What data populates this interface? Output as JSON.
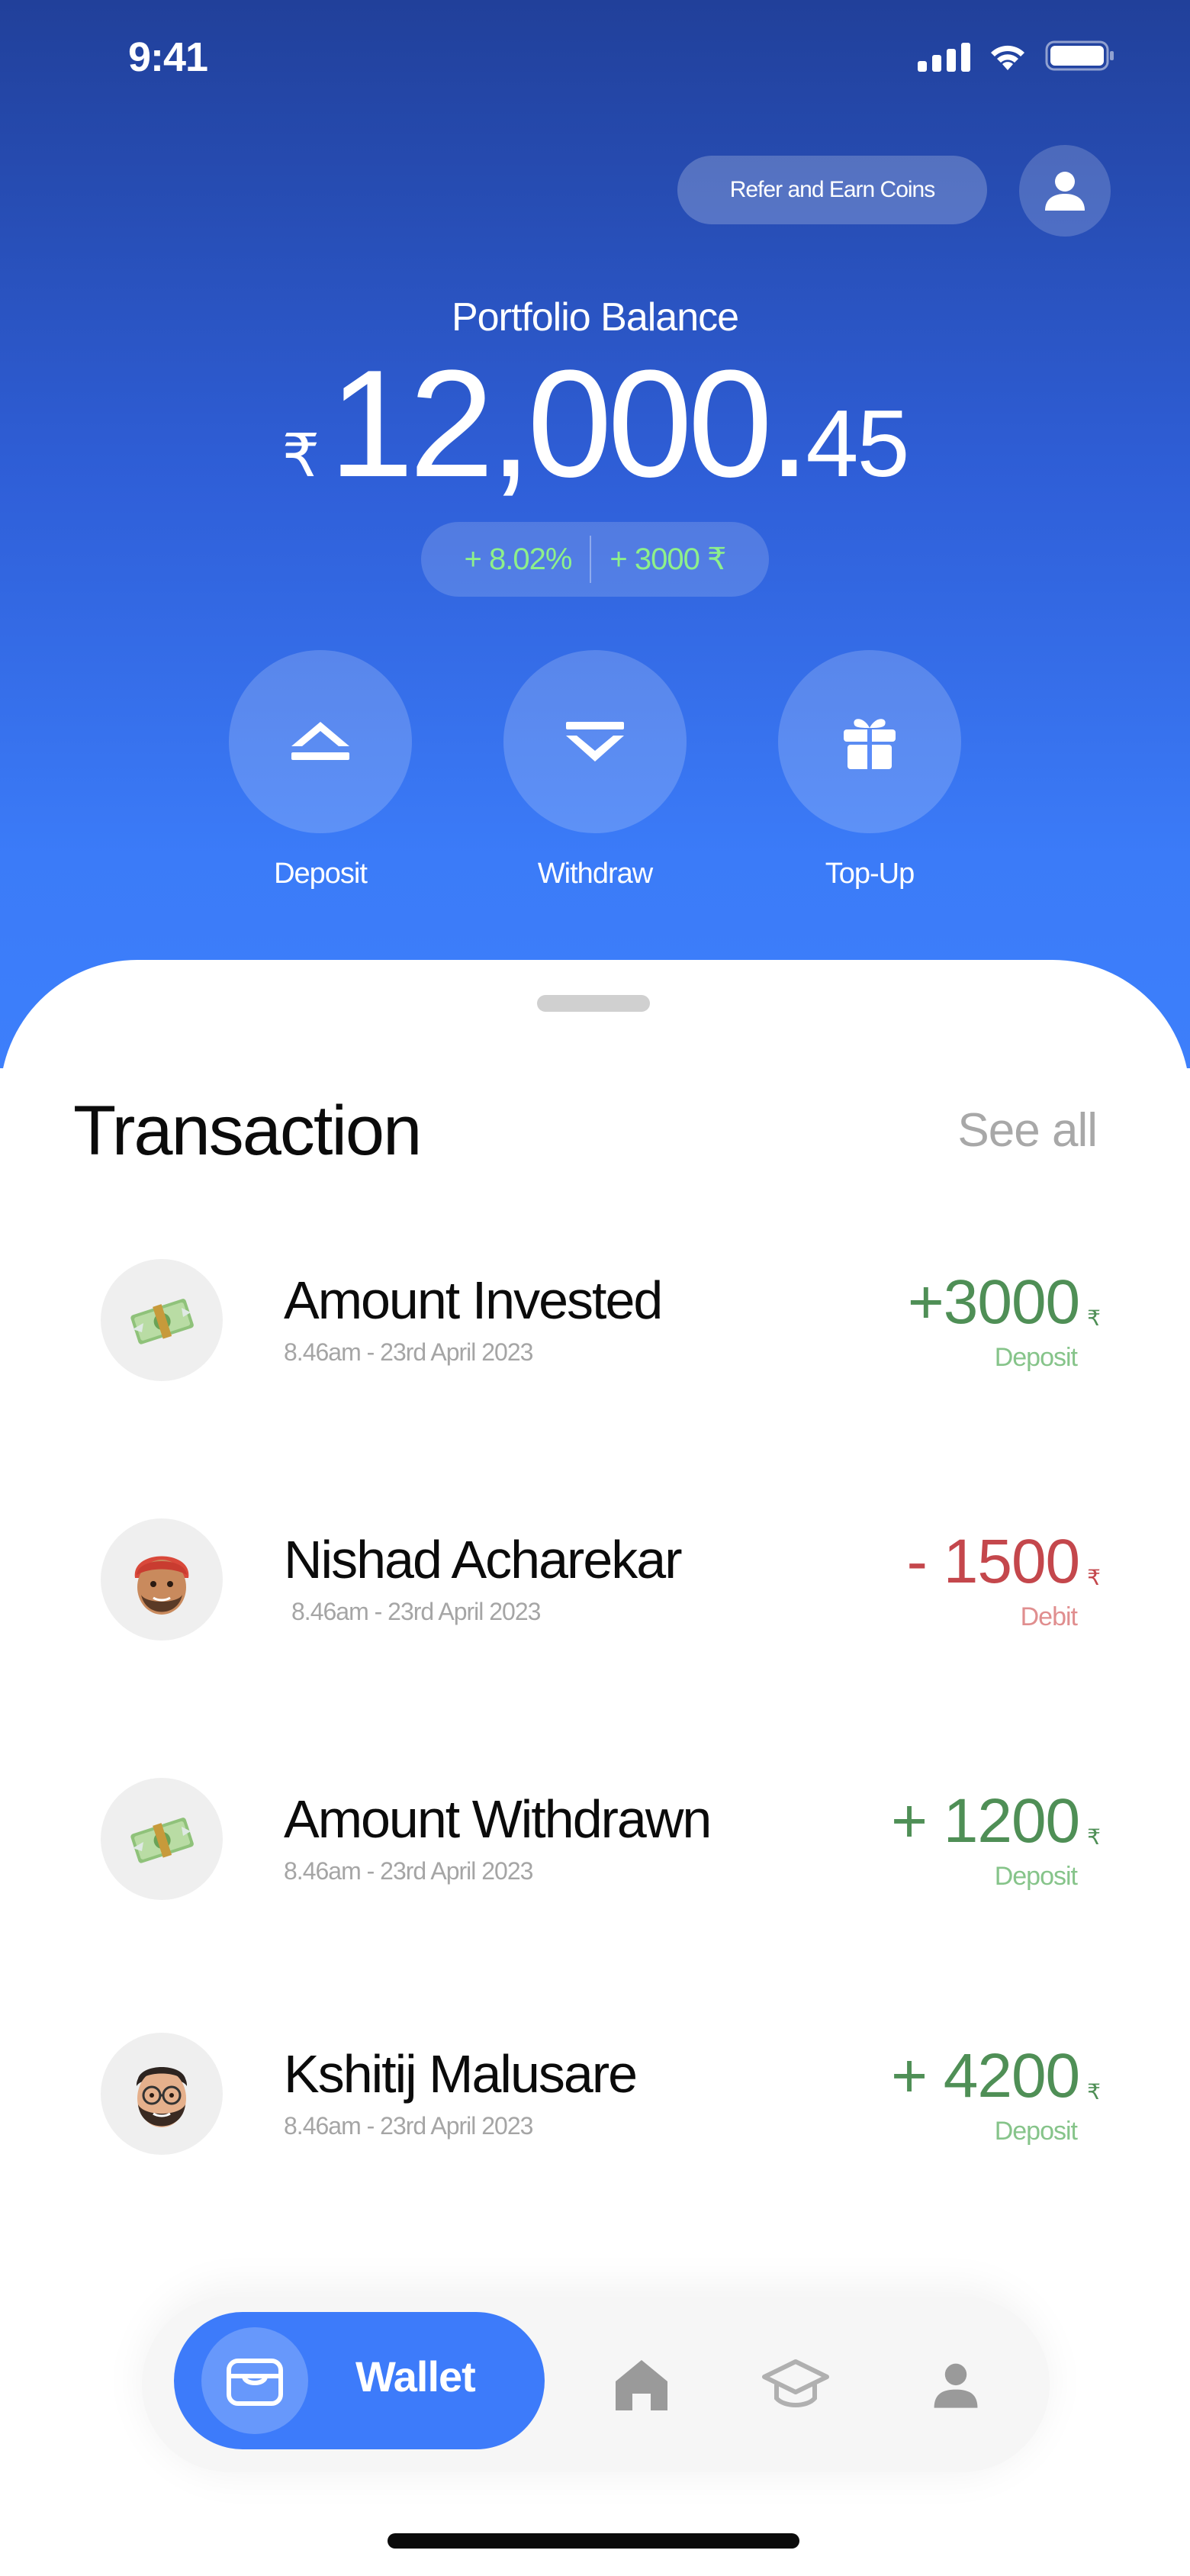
{
  "status_bar": {
    "time": "9:41",
    "icons": [
      "signal-icon",
      "wifi-icon",
      "battery-icon"
    ]
  },
  "header": {
    "refer_label": "Refer and Earn Coins",
    "profile_icon": "user-icon"
  },
  "portfolio": {
    "label": "Portfolio Balance",
    "currency_symbol": "₹",
    "balance_main": "12,000.",
    "balance_decimal": "45",
    "change_percent": "+ 8.02%",
    "change_amount": "+ 3000 ₹"
  },
  "actions": [
    {
      "label": "Deposit",
      "icon": "chevron-up-icon"
    },
    {
      "label": "Withdraw",
      "icon": "chevron-down-icon"
    },
    {
      "label": "Top-Up",
      "icon": "gift-icon"
    }
  ],
  "transactions_section": {
    "title": "Transaction",
    "see_all": "See all"
  },
  "transactions": [
    {
      "name": "Amount Invested",
      "time": "8.46am -  23rd April 2023",
      "amount": "+3000",
      "currency": "₹",
      "type": "Deposit",
      "avatar": "money-icon"
    },
    {
      "name": "Nishad Acharekar",
      "time": "8.46am -  23rd April 2023",
      "amount": "- 1500",
      "currency": "₹",
      "type": "Debit",
      "avatar": "memoji-turban"
    },
    {
      "name": "Amount Withdrawn",
      "time": "8.46am -  23rd April 2023",
      "amount": "+ 1200",
      "currency": "₹",
      "type": "Deposit",
      "avatar": "money-icon"
    },
    {
      "name": "Kshitij Malusare",
      "time": "8.46am -  23rd April 2023",
      "amount": "+ 4200",
      "currency": "₹",
      "type": "Deposit",
      "avatar": "memoji-glasses"
    }
  ],
  "bottom_nav": {
    "active_label": "Wallet",
    "items": [
      "wallet-icon",
      "home-icon",
      "graduation-cap-icon",
      "user-icon"
    ]
  },
  "colors": {
    "primary": "#3d7bfa",
    "positive": "#4f8f56",
    "negative": "#c4474c",
    "gain": "#8ef08a"
  }
}
